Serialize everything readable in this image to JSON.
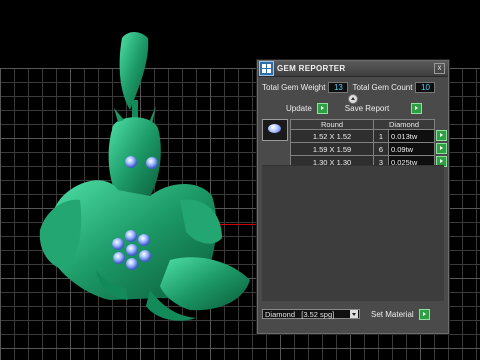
{
  "panel": {
    "title": "GEM REPORTER",
    "total_weight_label": "Total Gem Weight",
    "total_weight_value": "13",
    "total_count_label": "Total Gem Count",
    "total_count_value": "10",
    "update_label": "Update",
    "save_label": "Save Report",
    "table": {
      "headers": [
        "Round",
        "Diamond"
      ],
      "rows": [
        {
          "size": "1.52 X 1.52",
          "count": "1",
          "weight": "0.013tw"
        },
        {
          "size": "1.59 X 1.59",
          "count": "6",
          "weight": "0.09tw"
        },
        {
          "size": "1.30 X 1.30",
          "count": "3",
          "weight": "0.025tw"
        }
      ]
    },
    "material_select": "Diamond   [3.52 spg]",
    "set_material_label": "Set Material",
    "close_glyph": "x"
  },
  "colors": {
    "model": "#1f9e6e",
    "gem": "#7fa8ff",
    "go_button": "#2ea043",
    "panel_bg": "#4a4a4a"
  }
}
